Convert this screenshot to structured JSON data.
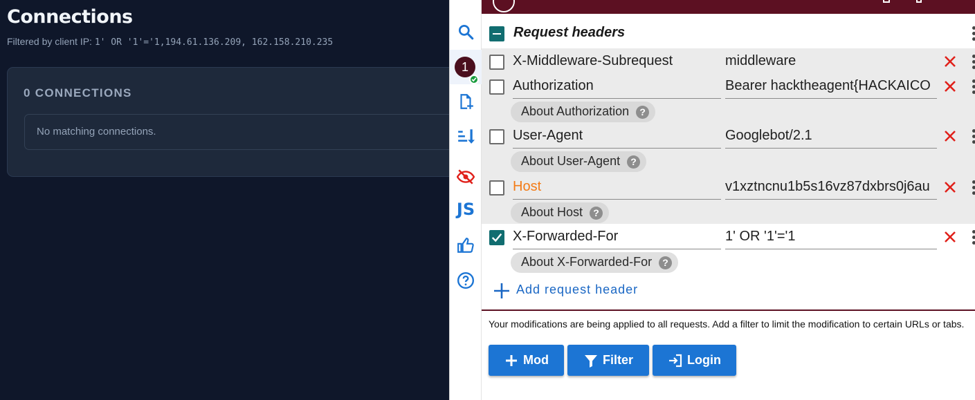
{
  "left": {
    "title": "Connections",
    "filter_label": "Filtered by client IP:",
    "filter_value": "1' OR '1'='1,194.61.136.209, 162.158.210.235",
    "count_label": "0 CONNECTIONS",
    "empty_message": "No matching connections."
  },
  "rail": {
    "items": [
      {
        "icon": "search-icon"
      },
      {
        "icon": "profile-badge",
        "label": "1"
      },
      {
        "icon": "add-file-icon"
      },
      {
        "icon": "sort-icon"
      },
      {
        "icon": "hidden-eye-icon"
      },
      {
        "icon": "js-icon",
        "label": "JS"
      },
      {
        "icon": "thumbs-up-icon"
      },
      {
        "icon": "help-icon"
      }
    ]
  },
  "section": {
    "title": "Request headers",
    "state": "indeterminate"
  },
  "headers": [
    {
      "name": "X-Middleware-Subrequest",
      "value": "middleware",
      "checked": false,
      "about": ""
    },
    {
      "name": "Authorization",
      "value": "Bearer hacktheagent{HACKAICO",
      "checked": false,
      "about": "About Authorization"
    },
    {
      "name": "User-Agent",
      "value": "Googlebot/2.1",
      "checked": false,
      "about": "About User-Agent"
    },
    {
      "name": "Host",
      "value": "v1xztncnu1b5s16vz87dxbrs0j6au",
      "checked": false,
      "about": "About Host"
    },
    {
      "name": "X-Forwarded-For",
      "value": "1' OR '1'='1",
      "checked": true,
      "about": "About X-Forwarded-For"
    }
  ],
  "add_header_label": "Add request header",
  "notice": "Your modifications are being applied to all requests. Add a filter to limit the modification to certain URLs or tabs.",
  "buttons": {
    "mod": "Mod",
    "filter": "Filter",
    "login": "Login"
  },
  "colors": {
    "brand": "#5c1022",
    "accent": "#1c75d4",
    "checkbox": "#116d70",
    "delete": "#e0201a",
    "host_warning": "#f37b16"
  }
}
